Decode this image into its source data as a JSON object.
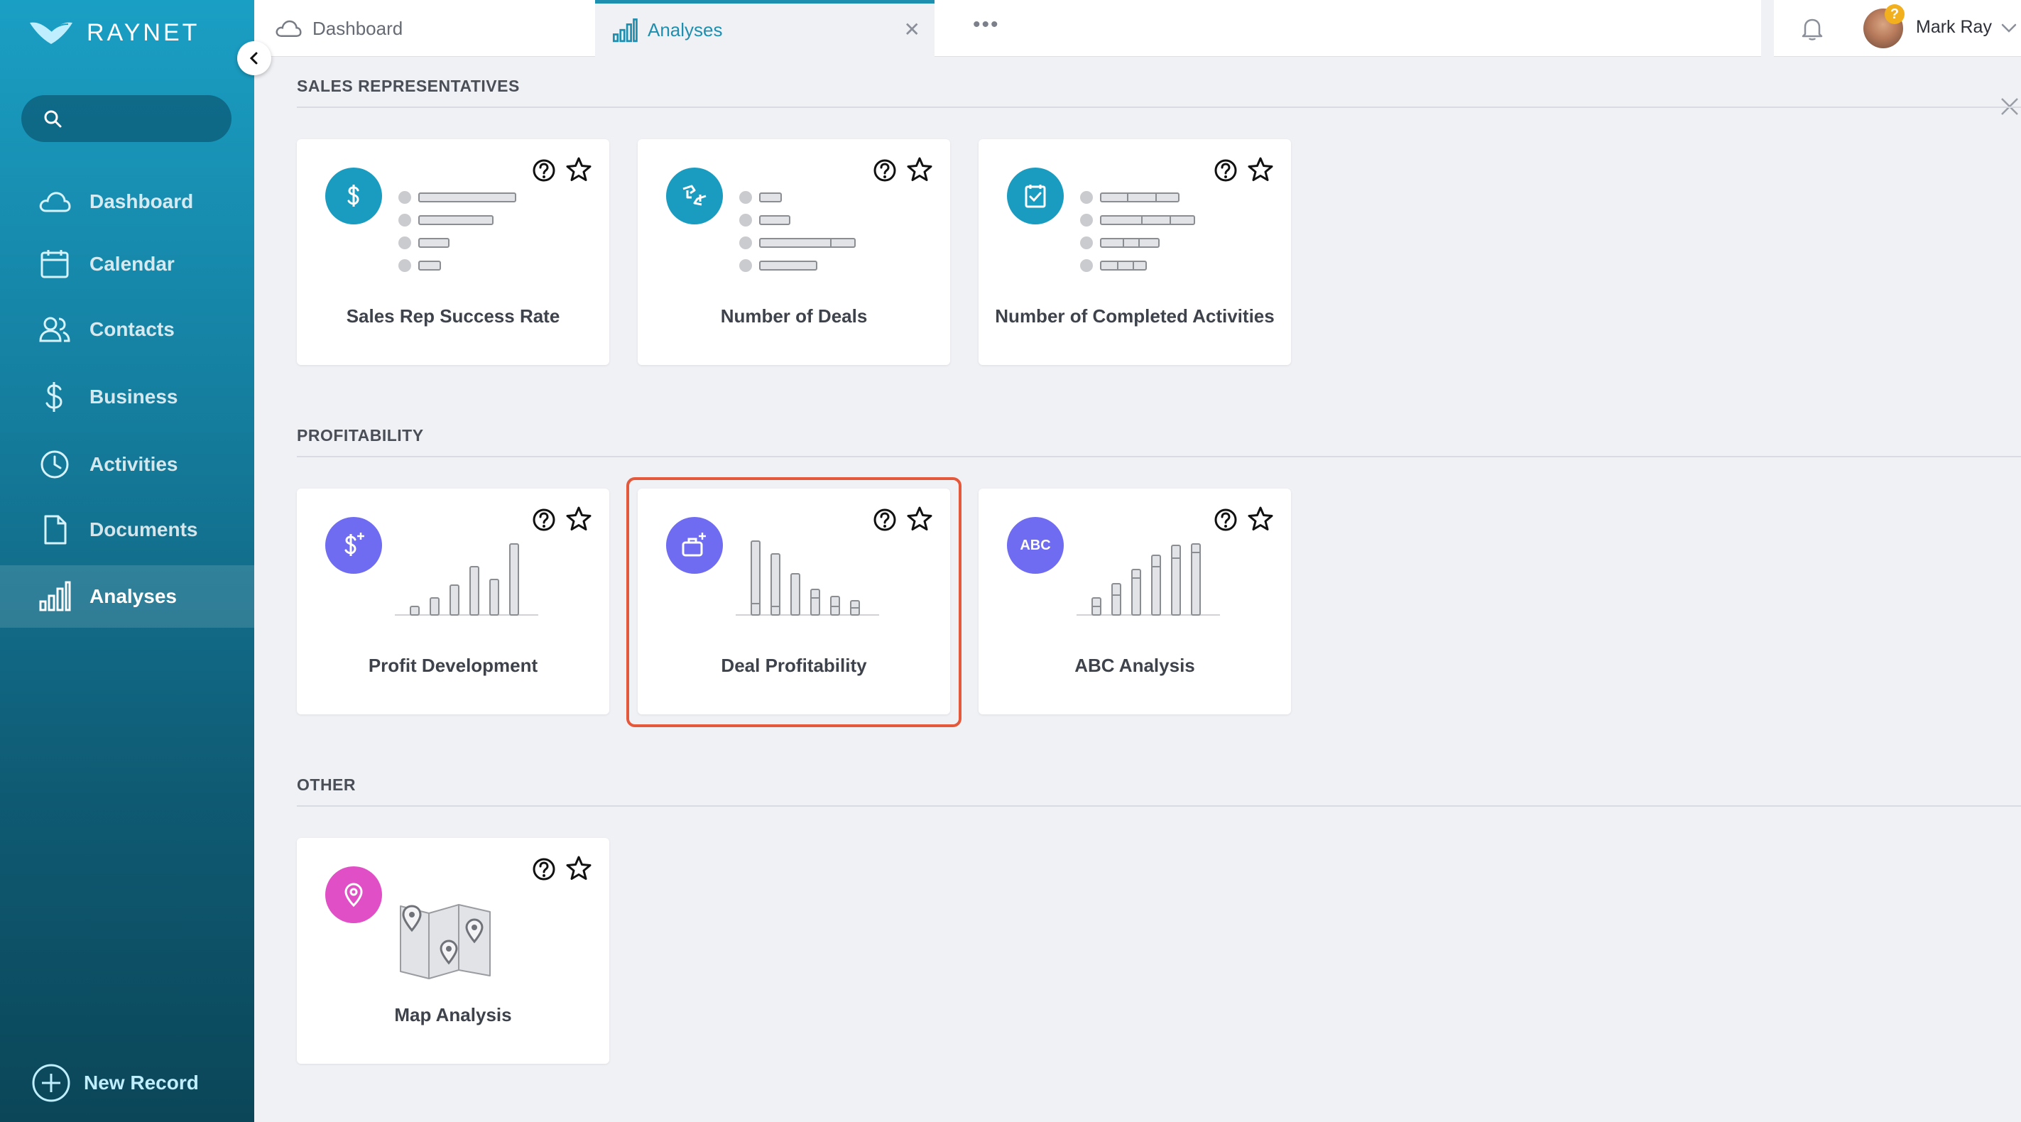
{
  "app": {
    "logo_text": "RAYNET"
  },
  "sidebar": {
    "search": {
      "placeholder": ""
    },
    "items": [
      {
        "label": "Dashboard",
        "icon": "cloud-icon"
      },
      {
        "label": "Calendar",
        "icon": "calendar-icon"
      },
      {
        "label": "Contacts",
        "icon": "contacts-icon"
      },
      {
        "label": "Business",
        "icon": "dollar-icon"
      },
      {
        "label": "Activities",
        "icon": "clock-icon"
      },
      {
        "label": "Documents",
        "icon": "document-icon"
      },
      {
        "label": "Analyses",
        "icon": "bar-chart-icon",
        "active": true
      }
    ],
    "new_record_label": "New Record"
  },
  "tabs": [
    {
      "label": "Dashboard",
      "icon": "cloud-icon"
    },
    {
      "label": "Analyses",
      "icon": "bar-chart-icon",
      "active": true
    }
  ],
  "tab_more": "•••",
  "user": {
    "name": "Mark Ray",
    "badge": "?"
  },
  "sections": [
    {
      "title": "SALES REPRESENTATIVES",
      "cards": [
        {
          "label": "Sales Rep Success Rate",
          "icon": "dollar-icon",
          "color": "#1a9bc0"
        },
        {
          "label": "Number of Deals",
          "icon": "handshake-icon",
          "color": "#1a9bc0"
        },
        {
          "label": "Number of Completed Activities",
          "icon": "checklist-icon",
          "color": "#1a9bc0"
        }
      ]
    },
    {
      "title": "PROFITABILITY",
      "cards": [
        {
          "label": "Profit Development",
          "icon": "dollar-plus-icon",
          "color": "#6f6cf2"
        },
        {
          "label": "Deal Profitability",
          "icon": "briefcase-plus-icon",
          "color": "#6f6cf2",
          "highlighted": true
        },
        {
          "label": "ABC Analysis",
          "icon": "abc-icon",
          "icon_text": "ABC",
          "color": "#6f6cf2"
        }
      ]
    },
    {
      "title": "OTHER",
      "cards": [
        {
          "label": "Map Analysis",
          "icon": "map-pin-icon",
          "color": "#e14fc6"
        }
      ]
    }
  ]
}
